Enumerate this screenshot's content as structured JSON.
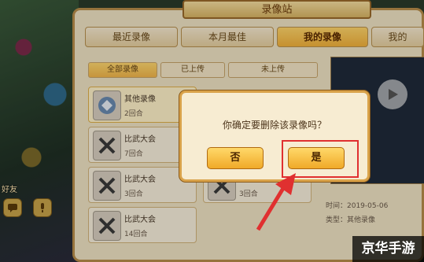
{
  "panel": {
    "title": "录像站"
  },
  "tabs": [
    {
      "label": "最近录像"
    },
    {
      "label": "本月最佳"
    },
    {
      "label": "我的录像"
    },
    {
      "label": "我的"
    }
  ],
  "subtabs": [
    {
      "label": "全部录像"
    },
    {
      "label": "已上传"
    },
    {
      "label": "未上传"
    }
  ],
  "records": [
    {
      "name": "其他录像",
      "rounds": "2回合"
    },
    {
      "name": "比武大会",
      "rounds": "7回合"
    },
    {
      "name": "比武大会",
      "rounds": "3回合"
    },
    {
      "name": "比武大会",
      "rounds": "14回合"
    },
    {
      "name": "比武大会",
      "rounds": "3回合"
    }
  ],
  "info": {
    "time": "时间：2019-05-06",
    "type": "类型：其他录像"
  },
  "dialog": {
    "message": "你确定要删除该录像吗？",
    "no_label": "否",
    "yes_label": "是"
  },
  "side": {
    "tag": "好友"
  },
  "watermark": "京华手游",
  "colors": {
    "highlight": "#e03030",
    "accent": "#f2b13a"
  }
}
